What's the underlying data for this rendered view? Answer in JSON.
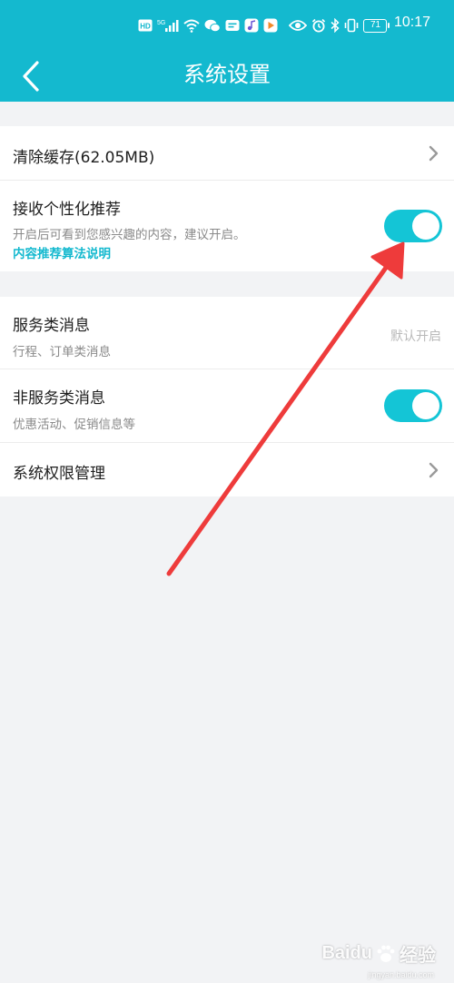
{
  "status_bar": {
    "time": "10:17",
    "battery": "71",
    "network": "5G",
    "icons": [
      "hd-icon",
      "signal-5g-icon",
      "wifi-icon",
      "wechat-icon",
      "message-icon",
      "music-icon",
      "video-icon",
      "eye-icon",
      "alarm-icon",
      "bluetooth-icon",
      "vibrate-icon",
      "battery-icon"
    ]
  },
  "header": {
    "title": "系统设置",
    "back_icon": "chevron-left-icon",
    "background_color": "#14b9cf"
  },
  "settings": {
    "clear_cache": {
      "label": "清除缓存(62.05MB)"
    },
    "personalized": {
      "label": "接收个性化推荐",
      "description": "开启后可看到您感兴趣的内容，建议开启。",
      "link": "内容推荐算法说明",
      "enabled": true
    },
    "service_messages": {
      "label": "服务类消息",
      "description": "行程、订单类消息",
      "value": "默认开启"
    },
    "non_service_messages": {
      "label": "非服务类消息",
      "description": "优惠活动、促销信息等",
      "enabled": true
    },
    "permissions": {
      "label": "系统权限管理"
    }
  },
  "colors": {
    "accent": "#14c5d6",
    "page_background": "#f2f3f5",
    "annotation_arrow": "#ee3b3b"
  },
  "watermark": {
    "brand": "Baidu",
    "cn": "经验",
    "sub": "jingyan.baidu.com"
  }
}
